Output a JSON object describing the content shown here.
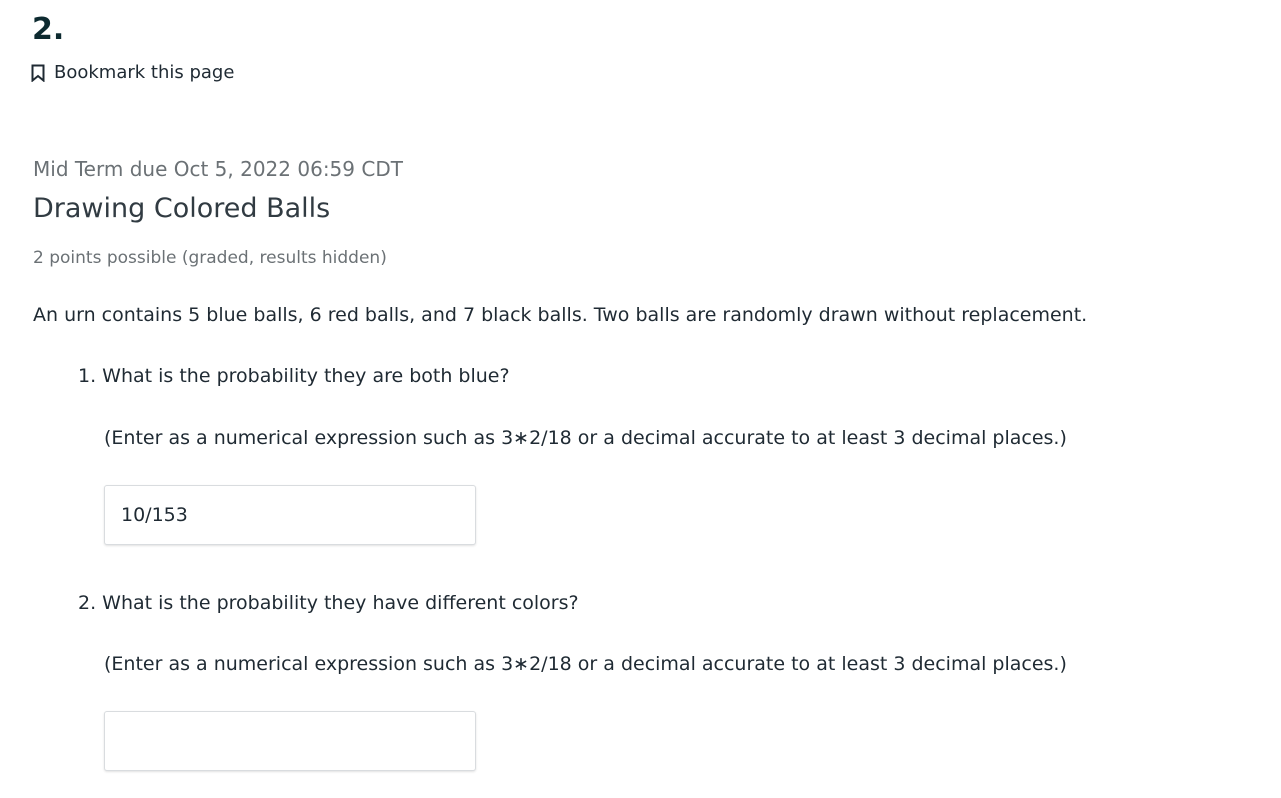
{
  "header": {
    "section_number": "2.",
    "bookmark_label": "Bookmark this page",
    "bookmark_icon": "bookmark-outline-icon"
  },
  "problem": {
    "due": "Mid Term due Oct 5, 2022 06:59 CDT",
    "title": "Drawing Colored Balls",
    "points": "2 points possible (graded, results hidden)",
    "statement": "An urn contains 5 blue balls, 6 red balls, and 7 black balls. Two balls are randomly drawn without replacement.",
    "questions": [
      {
        "text": "1. What is the probability they are both blue?",
        "hint": "(Enter as a numerical expression such as 3∗2/18 or a decimal accurate to at least 3 decimal places.)",
        "answer": "10/153"
      },
      {
        "text": "2. What is the probability they have different colors?",
        "hint": "(Enter as a numerical expression such as 3∗2/18 or a decimal accurate to at least 3 decimal places.)",
        "answer": ""
      }
    ]
  }
}
